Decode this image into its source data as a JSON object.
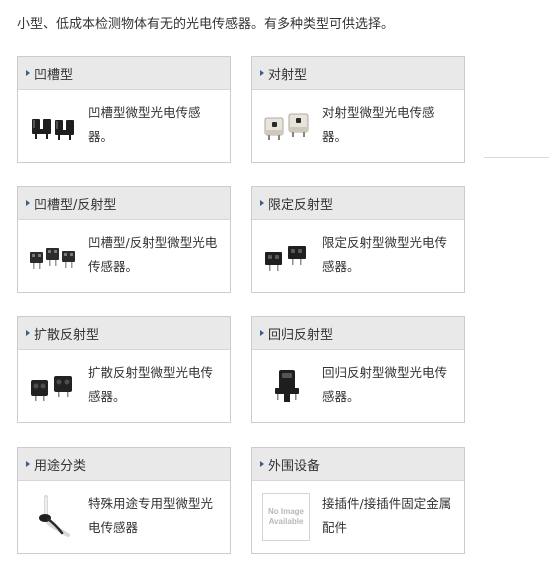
{
  "intro_text": "小型、低成本检测物体有无的光电传感器。有多种类型可供选择。",
  "colors": {
    "header_bg": "#e9e9e9",
    "card_border": "#cccccc",
    "arrow": "#3c5c8c",
    "text": "#333333"
  },
  "cards": [
    {
      "title": "凹槽型",
      "description": "凹槽型微型光电传感器。",
      "image": "slot-sensor-product-photo"
    },
    {
      "title": "对射型",
      "description": "对射型微型光电传感器。",
      "image": "through-beam-sensor-product-photo"
    },
    {
      "title": "凹槽型/反射型",
      "description": "凹槽型/反射型微型光电传感器。",
      "image": "slot-reflective-sensor-product-photo"
    },
    {
      "title": "限定反射型",
      "description": "限定反射型微型光电传感器。",
      "image": "limited-reflective-sensor-product-photo"
    },
    {
      "title": "扩散反射型",
      "description": "扩散反射型微型光电传感器。",
      "image": "diffuse-reflective-sensor-product-photo"
    },
    {
      "title": "回归反射型",
      "description": "回归反射型微型光电传感器。",
      "image": "retro-reflective-sensor-product-photo"
    },
    {
      "title": "用途分类",
      "description": "特殊用途专用型微型光电传感器",
      "image": "special-purpose-sensor-product-photo"
    },
    {
      "title": "外围设备",
      "description": "接插件/接插件固定金属配件",
      "image": "no-image-placeholder",
      "placeholder_line1": "No Image",
      "placeholder_line2": "Available"
    }
  ]
}
